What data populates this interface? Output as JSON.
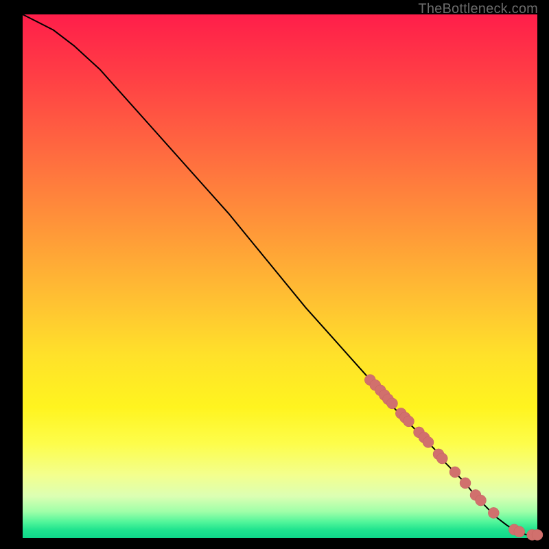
{
  "attribution": "TheBottleneck.com",
  "colors": {
    "bg": "#000000",
    "attribution_text": "#6b6b6b",
    "curve": "#000000",
    "marker_fill": "#d1706d",
    "marker_stroke": "#c36461",
    "gradient_stops": [
      "#ff1e4a",
      "#ff3f45",
      "#ff6f3f",
      "#ff9a38",
      "#ffc232",
      "#ffe12a",
      "#fff41f",
      "#fdfd4b",
      "#f3ff8e",
      "#dcffb3",
      "#9effa8",
      "#4ff59a",
      "#1ee28e",
      "#0fd78a"
    ]
  },
  "chart_data": {
    "type": "line",
    "title": "",
    "xlabel": "",
    "ylabel": "",
    "xlim": [
      0,
      100
    ],
    "ylim": [
      0,
      100
    ],
    "notes": "Monotone decreasing curve from top-left to bottom-right over a full-bleed vertical red→yellow→green gradient; no axis ticks or labels are rendered. Data points (pink markers) cluster along the curve's lower-right third.",
    "series": [
      {
        "name": "curve",
        "x": [
          0,
          3,
          6,
          10,
          15,
          20,
          25,
          30,
          35,
          40,
          45,
          50,
          55,
          60,
          65,
          70,
          72,
          75,
          78,
          80,
          82,
          84,
          86,
          88,
          90,
          92,
          94,
          96,
          98,
          100
        ],
        "y": [
          100,
          98.5,
          97,
          94,
          89.5,
          84,
          78.5,
          73,
          67.5,
          62,
          56,
          50,
          44,
          38.5,
          33,
          27.5,
          25,
          22,
          19,
          17,
          14.5,
          12.5,
          10.5,
          8,
          6,
          4,
          2.5,
          1.2,
          0.6,
          0.6
        ]
      },
      {
        "name": "markers",
        "x": [
          67.5,
          68.5,
          69.5,
          70.3,
          71.0,
          71.8,
          73.5,
          74.3,
          75.0,
          77.0,
          78.0,
          78.8,
          80.8,
          81.5,
          84.0,
          86.0,
          88.0,
          89.0,
          91.5,
          95.5,
          96.5,
          99.0,
          100.0
        ],
        "y": [
          30.2,
          29.2,
          28.2,
          27.3,
          26.5,
          25.7,
          23.8,
          23.0,
          22.3,
          20.2,
          19.2,
          18.3,
          16.0,
          15.2,
          12.6,
          10.5,
          8.2,
          7.2,
          4.8,
          1.6,
          1.2,
          0.6,
          0.6
        ]
      }
    ]
  }
}
